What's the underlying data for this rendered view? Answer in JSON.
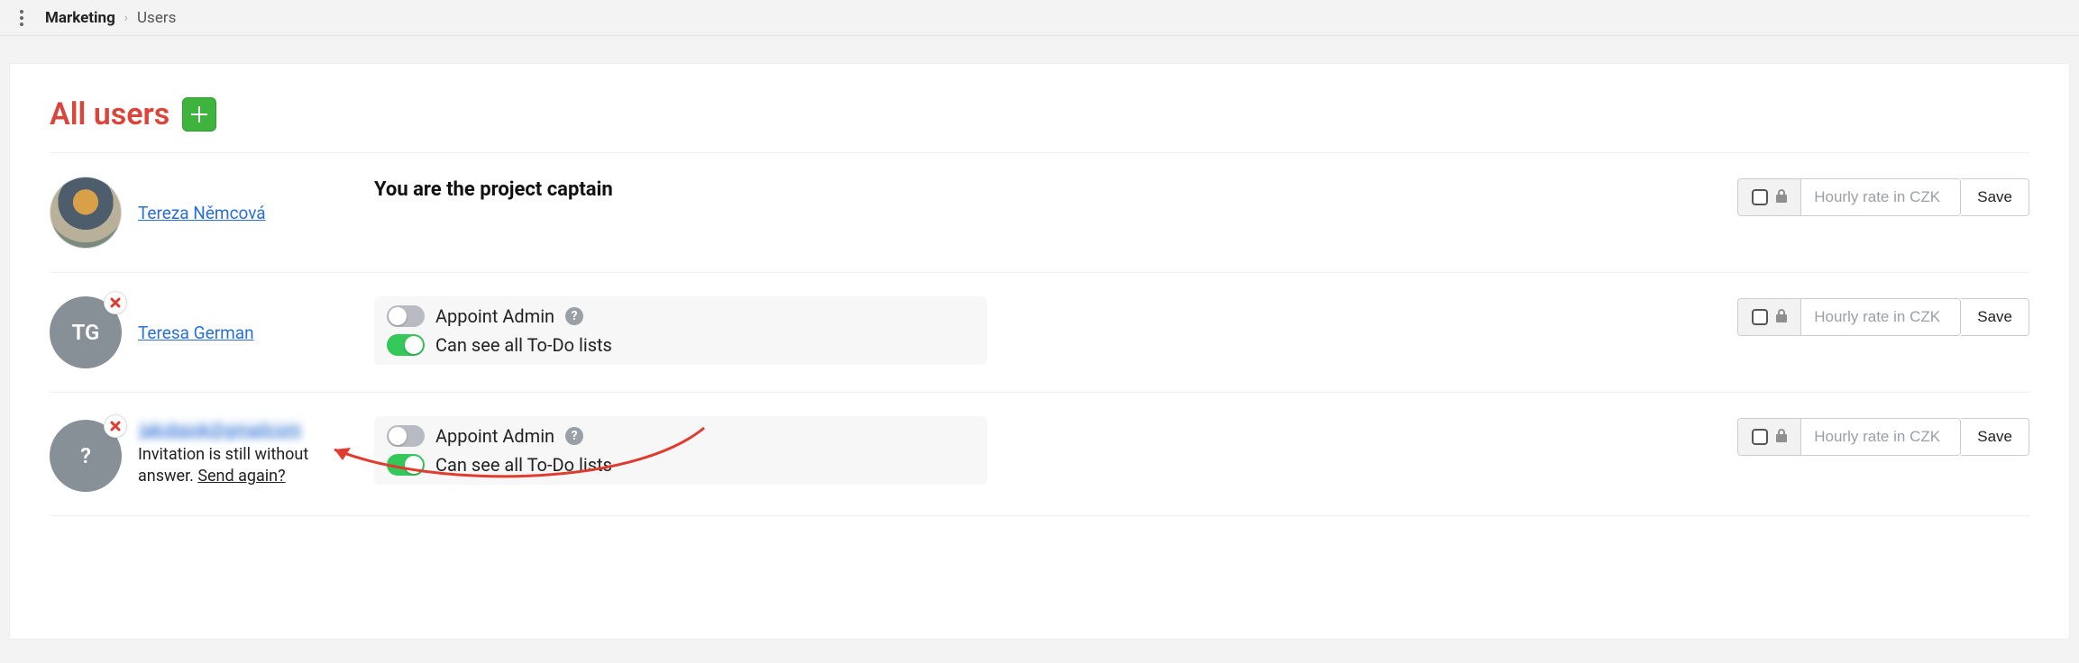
{
  "breadcrumb": {
    "root": "Marketing",
    "leaf": "Users"
  },
  "page": {
    "title": "All users"
  },
  "users": [
    {
      "name": "Tereza Němcová",
      "avatar_type": "photo",
      "role_text": "You are the project captain",
      "removable": false,
      "rate": {
        "placeholder": "Hourly rate in CZK",
        "save": "Save"
      }
    },
    {
      "name": "Teresa German",
      "initials": "TG",
      "avatar_type": "initials",
      "removable": true,
      "toggles": {
        "appoint_admin": {
          "label": "Appoint Admin",
          "on": false
        },
        "see_todo": {
          "label": "Can see all To-Do lists",
          "on": true
        }
      },
      "rate": {
        "placeholder": "Hourly rate in CZK",
        "save": "Save"
      }
    },
    {
      "name": "jakobpok@gmailcom",
      "initials": "?",
      "avatar_type": "initials",
      "blurred_name": true,
      "removable": true,
      "invite": {
        "msg_prefix": "Invitation is still without answer. ",
        "resend": "Send again?"
      },
      "toggles": {
        "appoint_admin": {
          "label": "Appoint Admin",
          "on": false
        },
        "see_todo": {
          "label": "Can see all To-Do lists",
          "on": true
        }
      },
      "rate": {
        "placeholder": "Hourly rate in CZK",
        "save": "Save"
      }
    }
  ]
}
